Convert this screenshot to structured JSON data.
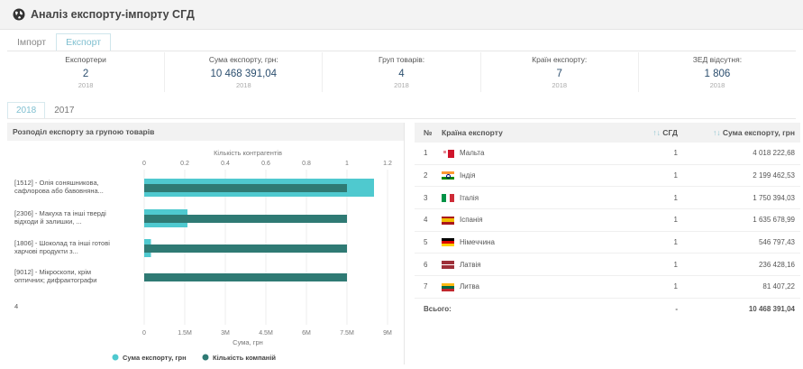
{
  "header": {
    "title": "Аналіз експорту-імпорту СГД"
  },
  "tabs": [
    "Імпорт",
    "Експорт"
  ],
  "stats": [
    {
      "label": "Експортери",
      "value": "2",
      "year": "2018"
    },
    {
      "label": "Сума експорту, грн:",
      "value": "10 468 391,04",
      "year": "2018"
    },
    {
      "label": "Груп товарів:",
      "value": "4",
      "year": "2018"
    },
    {
      "label": "Країн експорту:",
      "value": "7",
      "year": "2018"
    },
    {
      "label": "ЗЕД відсутня:",
      "value": "1 806",
      "year": "2018"
    }
  ],
  "year_tabs": [
    "2018",
    "2017"
  ],
  "left_panel": {
    "title": "Розподіл експорту за групою товарів"
  },
  "chart_data": {
    "type": "bar",
    "orientation": "horizontal",
    "categories": [
      "[1512] - Олія соняшникова, сафлорова або бавовняна...",
      "[2306] - Макуха та інші тверді відходи й залишки, ...",
      "[1806] - Шоколад та інші готові харчові продукти з...",
      "[9012] - Мікроскопи, крім оптичних; дифрактографи"
    ],
    "category_lines": [
      [
        "[1512] - Олія соняшникова,",
        "сафлорова або бавовняна..."
      ],
      [
        "[2306] - Макуха та інші тверді",
        "відходи й залишки, ..."
      ],
      [
        "[1806] - Шоколад та інші готові",
        "харчові продукти з..."
      ],
      [
        "[9012] - Мікроскопи, крім",
        "оптичних; дифрактографи"
      ]
    ],
    "extra_label": "4",
    "series": [
      {
        "name": "Сума експорту, грн",
        "axis": "bottom",
        "color": "#4fc9cf",
        "values": [
          8500000,
          1600000,
          250000,
          0
        ]
      },
      {
        "name": "Кількість компаній",
        "axis": "top",
        "color": "#2f7a74",
        "values": [
          1,
          1,
          1,
          1
        ]
      }
    ],
    "top_axis": {
      "label": "Кількість контрагентів",
      "ticks": [
        "0",
        "0.2",
        "0.4",
        "0.6",
        "0.8",
        "1",
        "1.2"
      ],
      "range": [
        0,
        1.2
      ]
    },
    "bottom_axis": {
      "label": "Сума, грн",
      "ticks": [
        "0",
        "1.5M",
        "3M",
        "4.5M",
        "6M",
        "7.5M",
        "9M"
      ],
      "range": [
        0,
        9000000
      ]
    },
    "legend_position": "bottom"
  },
  "table": {
    "headers": {
      "num": "№",
      "country": "Країна експорту",
      "sgd": "СГД",
      "sum": "Сума експорту, грн",
      "sort_icon": "↑↓"
    },
    "rows": [
      {
        "num": "1",
        "country": "Мальта",
        "flag": "malta",
        "sgd": "1",
        "sum": "4 018 222,68"
      },
      {
        "num": "2",
        "country": "Індія",
        "flag": "india",
        "sgd": "1",
        "sum": "2 199 462,53"
      },
      {
        "num": "3",
        "country": "Італія",
        "flag": "italy",
        "sgd": "1",
        "sum": "1 750 394,03"
      },
      {
        "num": "4",
        "country": "Іспанія",
        "flag": "spain",
        "sgd": "1",
        "sum": "1 635 678,99"
      },
      {
        "num": "5",
        "country": "Німеччина",
        "flag": "germany",
        "sgd": "1",
        "sum": "546 797,43"
      },
      {
        "num": "6",
        "country": "Латвія",
        "flag": "latvia",
        "sgd": "1",
        "sum": "236 428,16"
      },
      {
        "num": "7",
        "country": "Литва",
        "flag": "lithuania",
        "sgd": "1",
        "sum": "81 407,22"
      }
    ],
    "total": {
      "label": "Всього:",
      "sgd": "-",
      "sum": "10 468 391,04"
    }
  }
}
